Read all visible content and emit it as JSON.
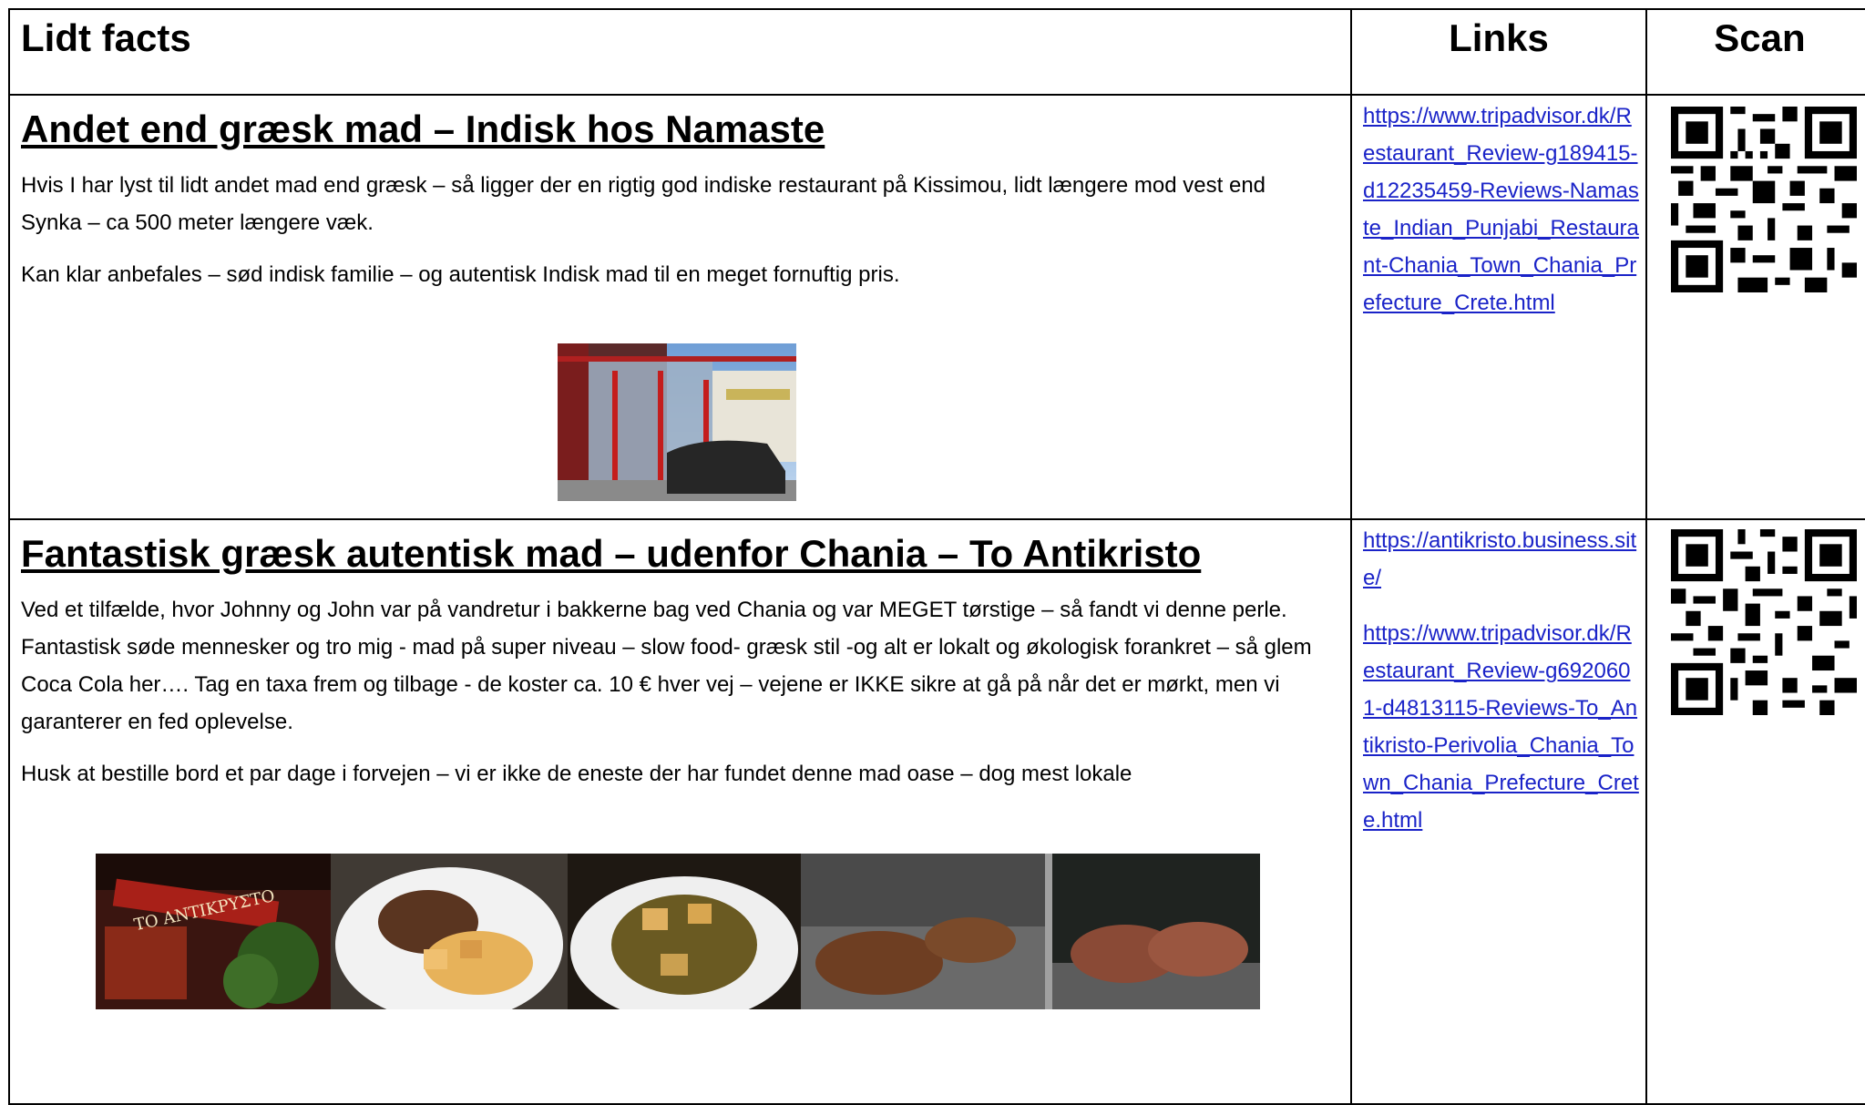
{
  "header": {
    "col1": "Lidt facts",
    "col2": "Links",
    "col3": "Scan"
  },
  "sections": [
    {
      "title": "Andet end græsk mad – Indisk hos Namaste",
      "paragraphs": [
        "Hvis I har lyst til lidt andet mad end græsk – så ligger der en rigtig god indiske restaurant på Kissimou, lidt længere mod vest end Synka – ca 500 meter længere væk.",
        "Kan klar anbefales – sød indisk familie – og autentisk Indisk mad til en meget fornuftig pris."
      ],
      "links": [
        "https://www.tripadvisor.dk/Restaurant_Review-g189415-d12235459-Reviews-Namaste_Indian_Punjabi_Restaurant-Chania_Town_Chania_Prefecture_Crete.html"
      ]
    },
    {
      "title": "Fantastisk græsk autentisk mad – udenfor Chania – To Antikristo",
      "paragraphs": [
        "Ved et tilfælde, hvor Johnny og John var på vandretur i bakkerne bag ved Chania og var MEGET tørstige – så fandt vi denne perle. Fantastisk søde mennesker og tro mig - mad på super niveau – slow food-  græsk stil -og alt er lokalt og økologisk forankret – så glem Coca Cola her…. Tag en taxa frem og tilbage  - de koster ca. 10 € hver vej – vejene er IKKE sikre at gå på når det er mørkt, men vi garanterer en fed oplevelse.",
        "Husk at bestille bord et par dage i forvejen – vi er ikke de eneste der har fundet denne mad oase – dog mest lokale"
      ],
      "links": [
        "https://antikristo.business.site/",
        "https://www.tripadvisor.dk/Restaurant_Review-g6920601-d4813115-Reviews-To_Antikristo-Perivolia_Chania_Town_Chania_Prefecture_Crete.html"
      ],
      "sign_text": "TO ANTIKPYΣTO"
    }
  ],
  "colors": {
    "link": "#1a23c8",
    "border": "#000000"
  }
}
